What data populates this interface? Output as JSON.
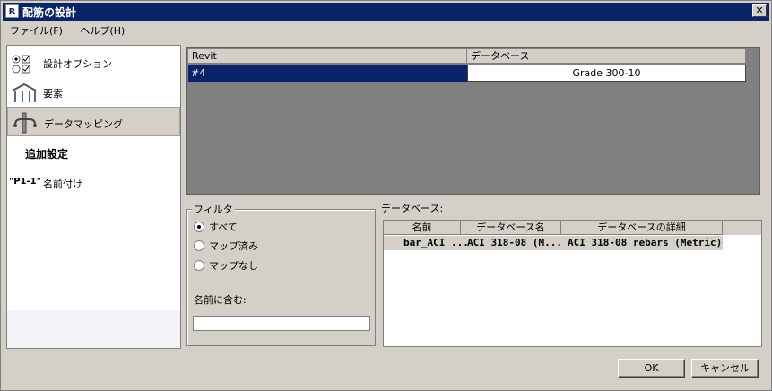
{
  "window": {
    "title": "配筋の設計",
    "app_icon": "R"
  },
  "menu": [
    {
      "label": "ファイル(F)"
    },
    {
      "label": "ヘルプ(H)"
    }
  ],
  "nav": {
    "items": [
      {
        "label": "設計オプション",
        "icon": "radio-checkbox-options-icon"
      },
      {
        "label": "要素",
        "icon": "structure-elements-icon"
      },
      {
        "label": "データマッピング",
        "icon": "rebar-mapping-icon"
      },
      {
        "label": "追加設定"
      },
      {
        "label": "名前付け",
        "icon_text": "\"P1-1\""
      }
    ]
  },
  "mapping": {
    "headers": [
      "Revit",
      "データベース"
    ],
    "rows": [
      {
        "revit": "#4",
        "database": "Grade 300-10"
      }
    ]
  },
  "filter": {
    "legend": "フィルタ",
    "options": [
      {
        "label": "すべて",
        "checked": true
      },
      {
        "label": "マップ済み",
        "checked": false
      },
      {
        "label": "マップなし",
        "checked": false
      }
    ],
    "contains_label": "名前に含む:",
    "contains_value": ""
  },
  "database": {
    "label": "データベース:",
    "headers": [
      "名前",
      "データベース名",
      "データベースの詳細"
    ],
    "rows": [
      {
        "name": "bar_ACI ...",
        "db_name": "ACI 318-08 (M...",
        "detail": "ACI 318-08 rebars (Metric)"
      }
    ]
  },
  "buttons": {
    "ok": "OK",
    "cancel": "キャンセル"
  },
  "colors": {
    "selection": "#0a246a",
    "panel": "#808080",
    "face": "#d4d0c8"
  }
}
